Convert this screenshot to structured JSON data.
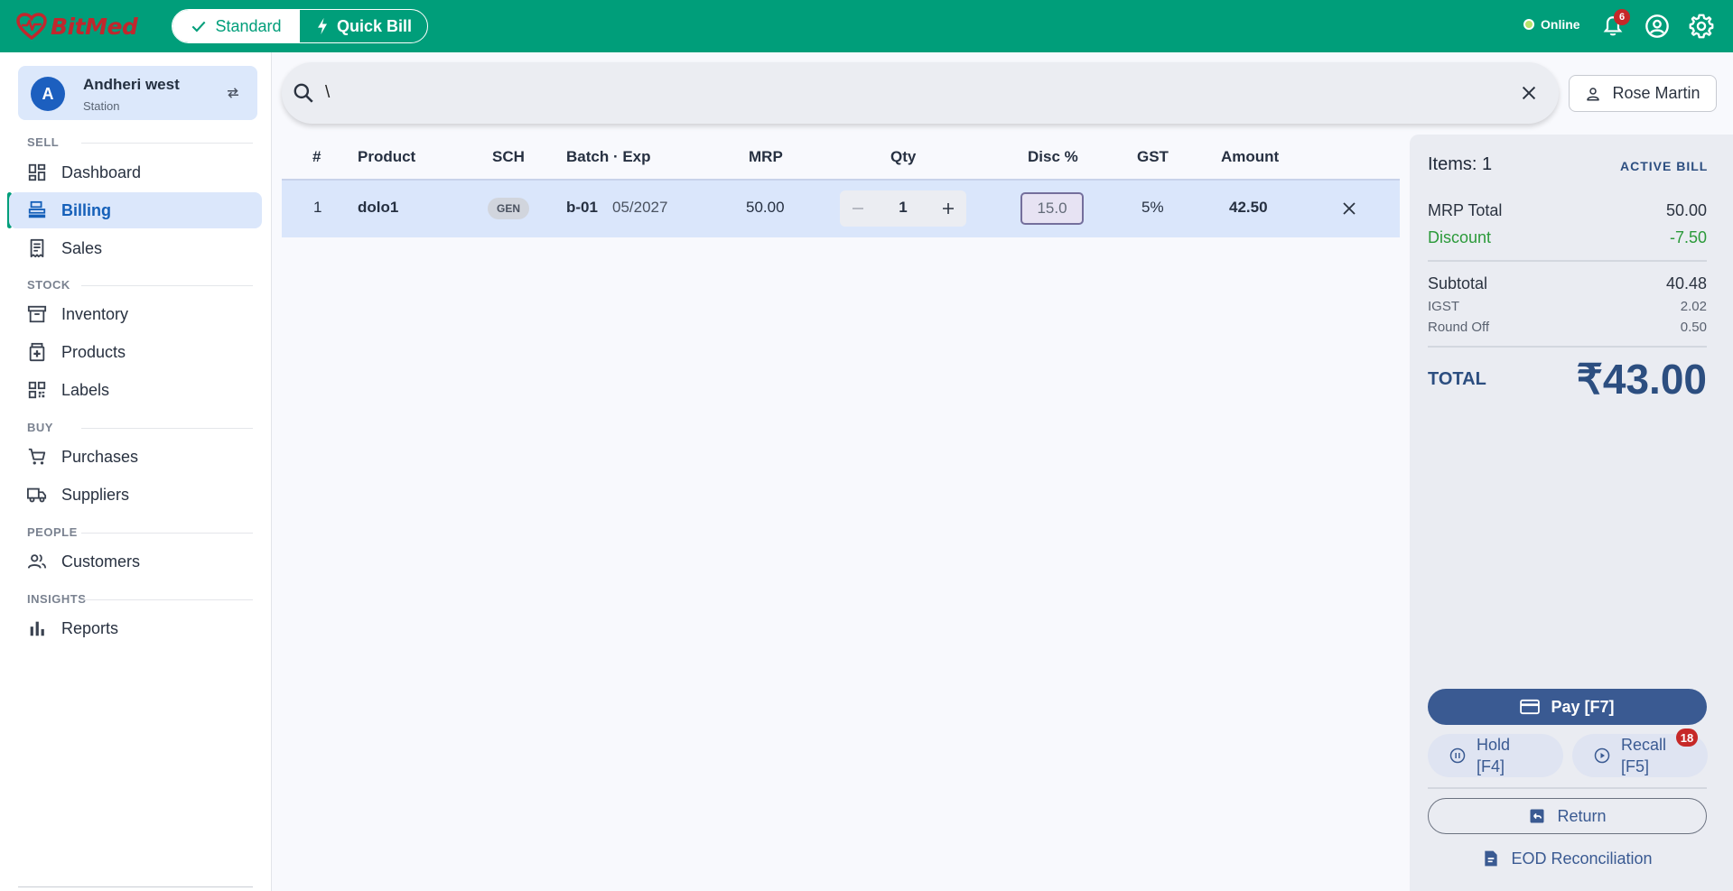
{
  "app": {
    "logo_text": "BitMed",
    "modes": {
      "standard": "Standard",
      "quick": "Quick Bill"
    },
    "status": "Online",
    "notification_count": "6"
  },
  "sidebar": {
    "station": {
      "avatar": "A",
      "name": "Andheri west",
      "role": "Station"
    },
    "sections": {
      "sell": "SELL",
      "stock": "STOCK",
      "buy": "BUY",
      "people": "PEOPLE",
      "insights": "INSIGHTS"
    },
    "items": {
      "dashboard": "Dashboard",
      "billing": "Billing",
      "sales": "Sales",
      "inventory": "Inventory",
      "products": "Products",
      "labels": "Labels",
      "purchases": "Purchases",
      "suppliers": "Suppliers",
      "customers": "Customers",
      "reports": "Reports"
    },
    "active_item": "billing"
  },
  "search": {
    "value": "\\"
  },
  "customer": {
    "name": "Rose Martin"
  },
  "table": {
    "headers": {
      "index": "#",
      "product": "Product",
      "sch": "SCH",
      "batch_exp": "Batch · Exp",
      "mrp": "MRP",
      "qty": "Qty",
      "disc": "Disc %",
      "gst": "GST",
      "amount": "Amount"
    },
    "rows": [
      {
        "index": "1",
        "product": "dolo1",
        "sch": "GEN",
        "batch": "b-01",
        "exp": "05/2027",
        "mrp": "50.00",
        "qty": "1",
        "disc": "15.0",
        "gst": "5%",
        "amount": "42.50"
      }
    ]
  },
  "summary": {
    "items_label": "Items: 1",
    "status": "ACTIVE BILL",
    "mrp_total_label": "MRP Total",
    "mrp_total": "50.00",
    "discount_label": "Discount",
    "discount": "-7.50",
    "subtotal_label": "Subtotal",
    "subtotal": "40.48",
    "igst_label": "IGST",
    "igst": "2.02",
    "round_off_label": "Round Off",
    "round_off": "0.50",
    "total_label": "TOTAL",
    "total": "₹43.00",
    "pay_label": "Pay  [F7]",
    "hold_line1": "Hold",
    "hold_line2": "[F4]",
    "recall_line1": "Recall",
    "recall_line2": "[F5]",
    "recall_count": "18",
    "return_label": "Return",
    "eod_label": "EOD Reconciliation"
  },
  "colors": {
    "brand": "#009e7a",
    "logo": "#c1272d",
    "active_nav_bg": "#dbe7fb",
    "active_nav_text": "#1560b9",
    "accent": "#3a5a92",
    "discount": "#2b9a3a",
    "badge": "#c62828"
  }
}
